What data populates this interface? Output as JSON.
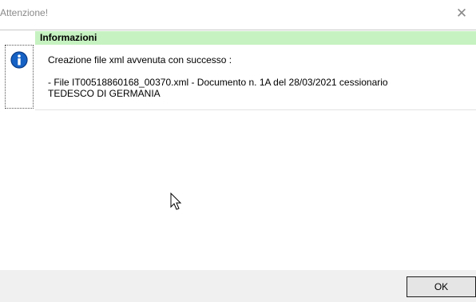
{
  "window": {
    "title": "Attenzione!",
    "close_glyph": "✕"
  },
  "panel": {
    "header": "Informazioni",
    "header_color": "#c6f2c1",
    "icon": "info-icon",
    "line1": "Creazione file xml avvenuta con successo :",
    "line2": " - File IT00518860168_00370.xml - Documento n. 1A del 28/03/2021 cessionario",
    "line3": "TEDESCO DI GERMANIA"
  },
  "footer": {
    "ok_label": "OK"
  },
  "cursor": "mouse-pointer-icon"
}
